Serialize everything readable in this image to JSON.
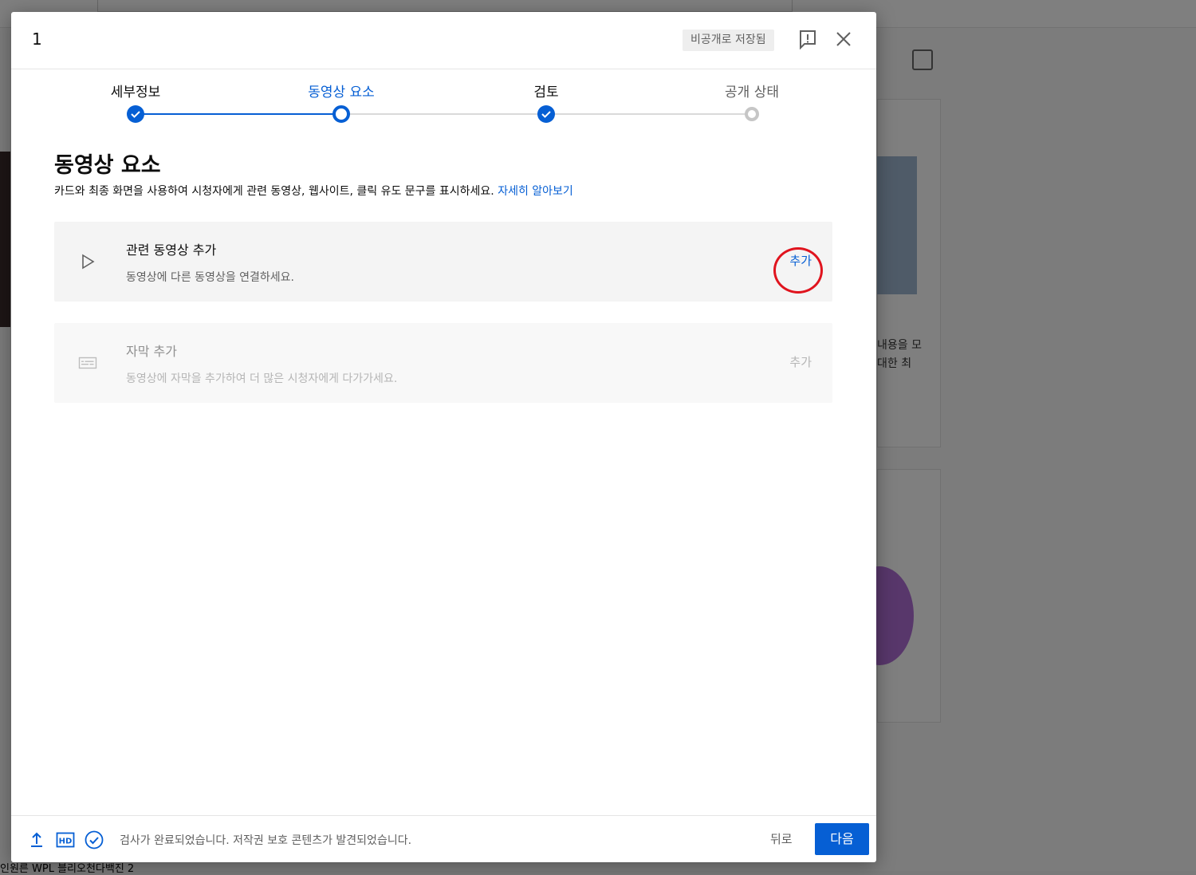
{
  "dialog": {
    "title": "1",
    "saved_badge": "비공개로 저장됨"
  },
  "stepper": {
    "steps": [
      {
        "label": "세부정보",
        "state": "done"
      },
      {
        "label": "동영상 요소",
        "state": "current"
      },
      {
        "label": "검토",
        "state": "done"
      },
      {
        "label": "공개 상태",
        "state": "todo"
      }
    ]
  },
  "section": {
    "title": "동영상 요소",
    "description": "카드와 최종 화면을 사용하여 시청자에게 관련 동영상, 웹사이트, 클릭 유도 문구를 표시하세요.",
    "learn_more": "자세히 알아보기"
  },
  "items": [
    {
      "title": "관련 동영상 추가",
      "subtitle": "동영상에 다른 동영상을 연결하세요.",
      "action": "추가",
      "icon": "play-icon",
      "enabled": true
    },
    {
      "title": "자막 추가",
      "subtitle": "동영상에 자막을 추가하여 더 많은 시청자에게 다가가세요.",
      "action": "추가",
      "icon": "subtitles-icon",
      "enabled": false
    }
  ],
  "footer": {
    "status": "검사가 완료되었습니다. 저작권 보호 콘텐츠가 발견되었습니다.",
    "back_label": "뒤로",
    "next_label": "다음"
  },
  "background": {
    "text_1": "내용을 모",
    "text_2": "대한 최",
    "bottom_text": "인원른 WPL 블리오천다백진 2"
  },
  "colors": {
    "accent": "#065fd4",
    "highlight_circle": "#e0141e"
  }
}
